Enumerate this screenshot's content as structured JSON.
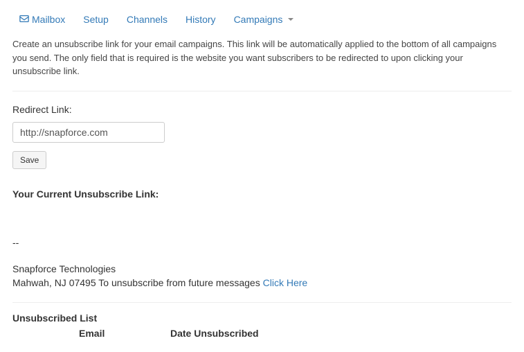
{
  "nav": {
    "mailbox": "Mailbox",
    "setup": "Setup",
    "channels": "Channels",
    "history": "History",
    "campaigns": "Campaigns"
  },
  "description": "Create an unsubscribe link for your email campaigns. This link will be automatically applied to the bottom of all campaigns you send. The only field that is required is the website you want subscribers to be redirected to upon clicking your unsubscribe link.",
  "form": {
    "redirect_label": "Redirect Link:",
    "redirect_value": "http://snapforce.com",
    "save_label": "Save"
  },
  "current_link": {
    "heading": "Your Current Unsubscribe Link:"
  },
  "signature": {
    "separator": "--",
    "company": "Snapforce Technologies",
    "address": "Mahwah, NJ 07495",
    "unsubscribe_prefix": " To unsubscribe from future messages ",
    "click_here": "Click Here"
  },
  "unsubscribed": {
    "heading": "Unsubscribed List",
    "col_email": "Email",
    "col_date": "Date Unsubscribed"
  }
}
